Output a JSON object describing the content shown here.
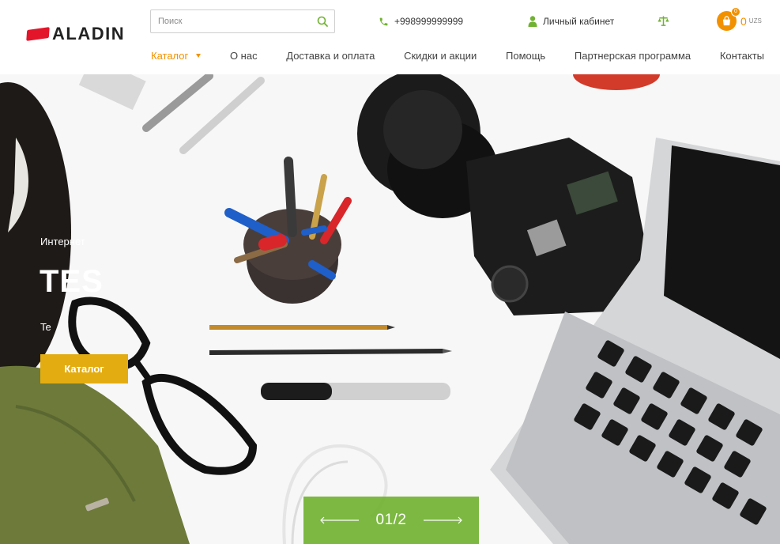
{
  "brand": {
    "name": "ALADIN"
  },
  "search": {
    "placeholder": "Поиск"
  },
  "header": {
    "phone": "+998999999999",
    "account_label": "Личный кабинет",
    "cart": {
      "badge": "0",
      "value": "0",
      "currency": "UZS"
    }
  },
  "nav": {
    "items": [
      {
        "label": "Каталог"
      },
      {
        "label": "О нас"
      },
      {
        "label": "Доставка и оплата"
      },
      {
        "label": "Скидки и акции"
      },
      {
        "label": "Помощь"
      },
      {
        "label": "Партнерская программа"
      },
      {
        "label": "Контакты"
      }
    ]
  },
  "hero": {
    "subtitle": "Интернет",
    "title": "TEST",
    "description": "Te",
    "button_label": "Каталог"
  },
  "slider": {
    "counter": "01/2"
  },
  "colors": {
    "accent": "#f29100",
    "green": "#71b232",
    "yellow": "#e3ad11",
    "red": "#e3152b"
  },
  "icons": [
    "search-icon",
    "phone-icon",
    "user-icon",
    "compare-icon",
    "cart-icon",
    "arrow-left-icon",
    "arrow-right-icon"
  ]
}
